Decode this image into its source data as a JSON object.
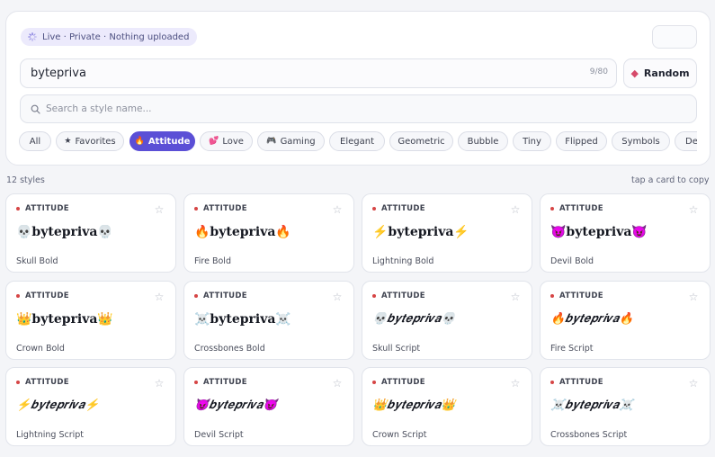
{
  "status_pill": {
    "label": "Live · Private · Nothing uploaded",
    "icon": "spinner-icon"
  },
  "name_input": {
    "value": "bytepriva",
    "counter": "9/80"
  },
  "random_button": {
    "label": "Random",
    "icon": "dice-icon"
  },
  "search": {
    "placeholder": "Search a style name...",
    "value": "",
    "icon": "search-icon"
  },
  "categories": [
    {
      "label": "All",
      "icon": "",
      "active": false
    },
    {
      "label": "Favorites",
      "icon": "★",
      "active": false
    },
    {
      "label": "Attitude",
      "icon": "🔥",
      "active": true
    },
    {
      "label": "Love",
      "icon": "💕",
      "active": false
    },
    {
      "label": "Gaming",
      "icon": "🎮",
      "active": false
    },
    {
      "label": "Elegant",
      "icon": "",
      "active": false
    },
    {
      "label": "Geometric",
      "icon": "",
      "active": false
    },
    {
      "label": "Bubble",
      "icon": "",
      "active": false
    },
    {
      "label": "Tiny",
      "icon": "",
      "active": false
    },
    {
      "label": "Flipped",
      "icon": "",
      "active": false
    },
    {
      "label": "Symbols",
      "icon": "",
      "active": false
    },
    {
      "label": "Deco",
      "icon": "",
      "active": false
    }
  ],
  "results": {
    "count_label": "12 styles",
    "hint": "tap a card to copy"
  },
  "cards": [
    {
      "tag": "ATTITUDE",
      "text": "💀bytepriva💀",
      "name": "Skull Bold",
      "script": false
    },
    {
      "tag": "ATTITUDE",
      "text": "🔥bytepriva🔥",
      "name": "Fire Bold",
      "script": false
    },
    {
      "tag": "ATTITUDE",
      "text": "⚡bytepriva⚡",
      "name": "Lightning Bold",
      "script": false
    },
    {
      "tag": "ATTITUDE",
      "text": "😈bytepriva😈",
      "name": "Devil Bold",
      "script": false
    },
    {
      "tag": "ATTITUDE",
      "text": "👑bytepriva👑",
      "name": "Crown Bold",
      "script": false
    },
    {
      "tag": "ATTITUDE",
      "text": "☠️bytepriva☠️",
      "name": "Crossbones Bold",
      "script": false
    },
    {
      "tag": "ATTITUDE",
      "text": "💀𝒃𝒚𝒕𝒆𝒑𝒓𝒊𝒗𝒂💀",
      "name": "Skull Script",
      "script": true
    },
    {
      "tag": "ATTITUDE",
      "text": "🔥𝒃𝒚𝒕𝒆𝒑𝒓𝒊𝒗𝒂🔥",
      "name": "Fire Script",
      "script": true
    },
    {
      "tag": "ATTITUDE",
      "text": "⚡𝒃𝒚𝒕𝒆𝒑𝒓𝒊𝒗𝒂⚡",
      "name": "Lightning Script",
      "script": true
    },
    {
      "tag": "ATTITUDE",
      "text": "😈𝒃𝒚𝒕𝒆𝒑𝒓𝒊𝒗𝒂😈",
      "name": "Devil Script",
      "script": true
    },
    {
      "tag": "ATTITUDE",
      "text": "👑𝒃𝒚𝒕𝒆𝒑𝒓𝒊𝒗𝒂👑",
      "name": "Crown Script",
      "script": true
    },
    {
      "tag": "ATTITUDE",
      "text": "☠️𝒃𝒚𝒕𝒆𝒑𝒓𝒊𝒗𝒂☠️",
      "name": "Crossbones Script",
      "script": true
    }
  ],
  "colors": {
    "accent": "#5b4fd6",
    "tag_dot": "#d64545",
    "dice": "#d64a6a"
  }
}
